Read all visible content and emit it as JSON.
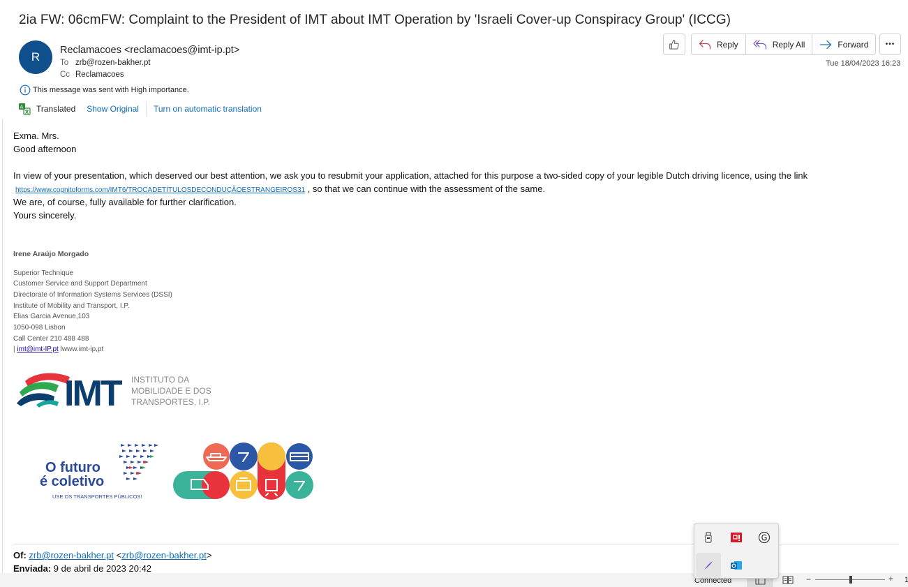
{
  "email": {
    "subject": "2ia FW: 06cmFW: Complaint to the President of IMT about IMT Operation by 'Israeli Cover-up Conspiracy Group' (ICCG)",
    "avatar_initial": "R",
    "sender": "Reclamacoes <reclamacoes@imt-ip.pt>",
    "to_label": "To",
    "to_value": "zrb@rozen-bakher.pt",
    "cc_label": "Cc",
    "cc_value": "Reclamacoes",
    "date": "Tue 18/04/2023 16:23",
    "importance": "This message was sent with High importance."
  },
  "toolbar": {
    "reply": "Reply",
    "reply_all": "Reply All",
    "forward": "Forward",
    "more": "•••"
  },
  "translation": {
    "status": "Translated",
    "show_original": "Show Original",
    "auto_translate": "Turn on automatic translation"
  },
  "body": {
    "greeting1": "Exma. Mrs.",
    "greeting2": "Good afternoon",
    "para1": "In view of your presentation, which deserved our best attention, we ask you to resubmit your application, attached for this purpose a two-sided copy of your legible Dutch driving licence, using the link",
    "link": "https://www.cognitoforms.com/IMT6/TROCADETÍTULOSDECONDUÇÃOESTRANGEIROS31",
    "para1_tail": " , so that we can continue with the assessment of the same.",
    "para2": "We are, of course, fully available for further clarification.",
    "closing": "Yours sincerely."
  },
  "signature": {
    "name": "Irene Araújo Morgado",
    "lines": [
      "Superior Technique",
      "Customer Service and Support Department",
      "Directorate of Information Systems Services (DSSI)",
      "Institute of Mobility and Transport, I.P.",
      "Elias Garcia Avenue,103",
      "1050-098 Lisbon",
      "Call Center 210 488 488"
    ],
    "pipe": "| ",
    "email_link": "imt@imt-IP.pt",
    "website": " lwww.imt-ip,pt",
    "logo_text": [
      "INSTITUTO DA",
      "MOBILIDADE E DOS",
      "TRANSPORTES, I.P."
    ],
    "logo_mark": "IMT",
    "futuro_line1": "O futuro",
    "futuro_line2": "é coletivo",
    "futuro_tag": "USE OS TRANSPORTES PÚBLICOS!"
  },
  "forwarded": {
    "of_label": "Of:",
    "of_value": "zrb@rozen-bakher.pt",
    "of_open": " <",
    "of_email": "zrb@rozen-bakher.pt",
    "of_close": ">",
    "sent_label": "Enviada:",
    "sent_value": " 9 de abril de 2023 20:42"
  },
  "statusbar": {
    "connected": "Connected",
    "zoom_minus": "−",
    "zoom_plus": "+",
    "zoom_value": "1"
  },
  "colors": {
    "accent": "#0f6cbd",
    "avatar": "#0f4f8b",
    "imt_blue": "#0b3d6e",
    "imt_teal": "#1aa59a",
    "imt_red": "#e8323c"
  }
}
